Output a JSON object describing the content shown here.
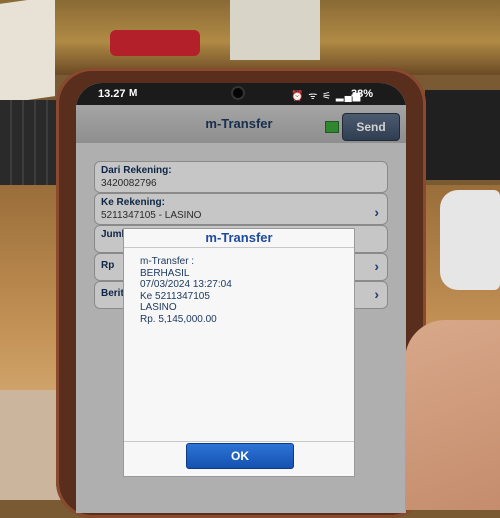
{
  "status_bar": {
    "time": "13.27",
    "mail_icon": "M",
    "icons": "⏰ ᯤ ⚟ ▂▄▆",
    "battery": "38%"
  },
  "app": {
    "title": "m-Transfer",
    "send_label": "Send",
    "status_color": "#3aa63a"
  },
  "form": {
    "from_account_label": "Dari Rekening:",
    "from_account_value": "3420082796",
    "to_account_label": "Ke Rekening:",
    "to_account_value": "5211347105 - LASINO",
    "amount_label_partial": "Juml",
    "currency_label_partial": "Rp",
    "news_label_partial": "Berit"
  },
  "dialog": {
    "title": "m-Transfer",
    "lines": [
      "m-Transfer :",
      "BERHASIL",
      "07/03/2024 13:27:04",
      "Ke 5211347105",
      "LASINO",
      "Rp. 5,145,000.00"
    ],
    "ok_label": "OK"
  }
}
